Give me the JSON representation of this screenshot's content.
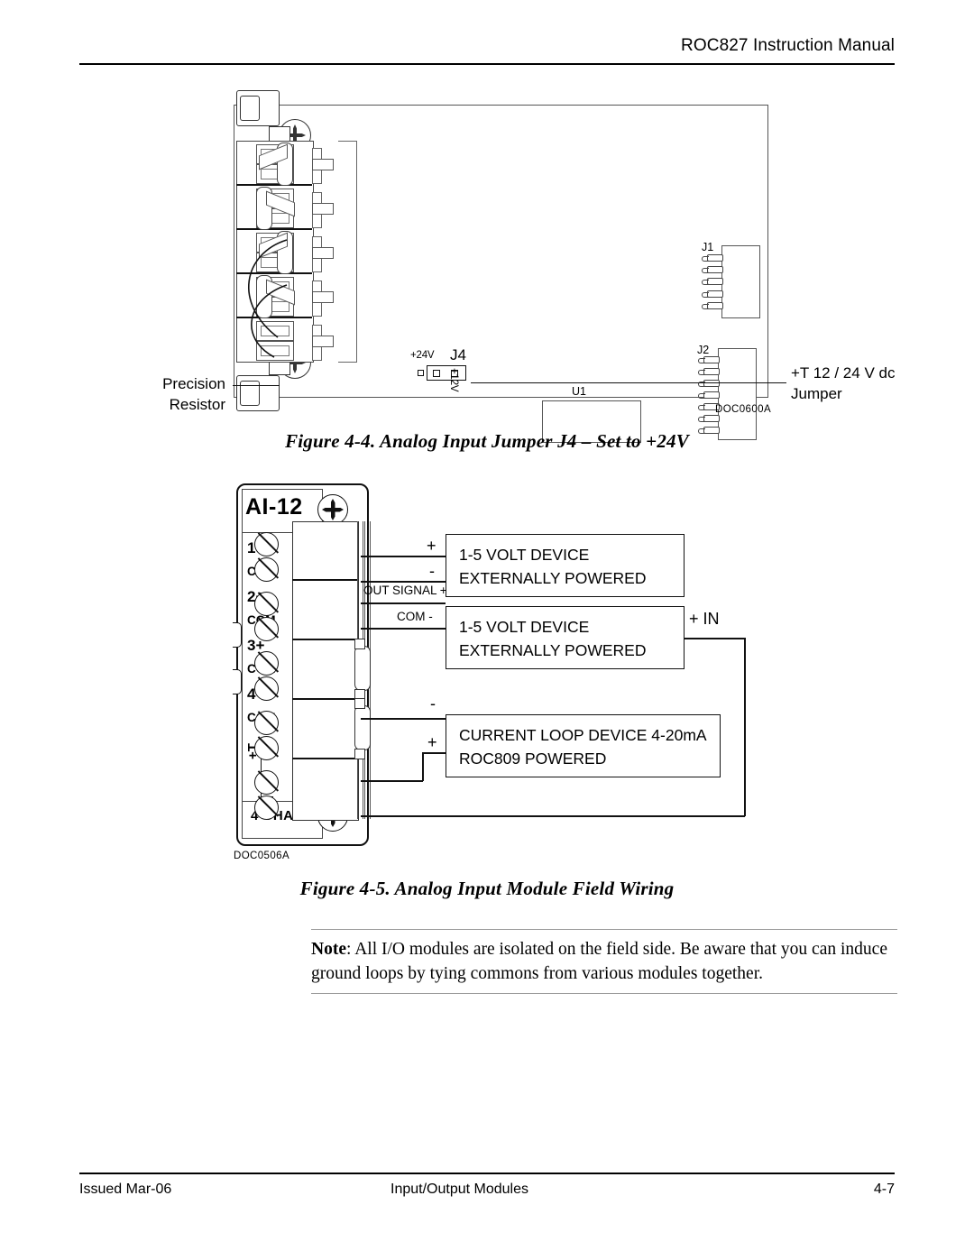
{
  "header": {
    "title": "ROC827 Instruction Manual"
  },
  "footer": {
    "issued": "Issued Mar-06",
    "section": "Input/Output Modules",
    "page": "4-7"
  },
  "figure_44": {
    "caption": "Figure 4-4. Analog Input Jumper J4 – Set to +24V",
    "doc_id": "DOC0600A",
    "callouts": {
      "precision_resistor_line1": "Precision",
      "precision_resistor_line2": "Resistor",
      "jumper_line1": "+T 12 / 24 V dc",
      "jumper_line2": "Jumper"
    },
    "board_labels": {
      "j1": "J1",
      "j2": "J2",
      "u1": "U1",
      "j4": "J4",
      "j4_plus24v": "+24V",
      "j4_plus12v": "+12V"
    }
  },
  "figure_45": {
    "caption": "Figure 4-5. Analog Input Module Field Wiring",
    "doc_id": "DOC0506A",
    "module": {
      "title": "AI-12",
      "channels_label": "4  CHAN",
      "terminals": [
        "1+",
        "COM",
        "2+",
        "COM",
        "3+",
        "COM",
        "4+",
        "COM"
      ],
      "power_terminal": "+T"
    },
    "devices": [
      {
        "line1": "1-5 VOLT DEVICE",
        "line2": "EXTERNALLY POWERED",
        "terminal_plus": "+",
        "terminal_minus": "-"
      },
      {
        "line1": "1-5 VOLT DEVICE",
        "line2": "EXTERNALLY POWERED",
        "terminal_plus": "OUT SIGNAL +",
        "terminal_minus": "COM -"
      },
      {
        "line1": "CURRENT LOOP DEVICE 4-20mA",
        "line2": "ROC809 POWERED",
        "terminal_plus": "+",
        "terminal_minus": "-"
      }
    ],
    "loop_input_label": "+ IN"
  },
  "note": {
    "label": "Note",
    "text": ": All I/O modules are isolated on the field side. Be aware that you can induce ground loops by tying commons from various modules together."
  }
}
